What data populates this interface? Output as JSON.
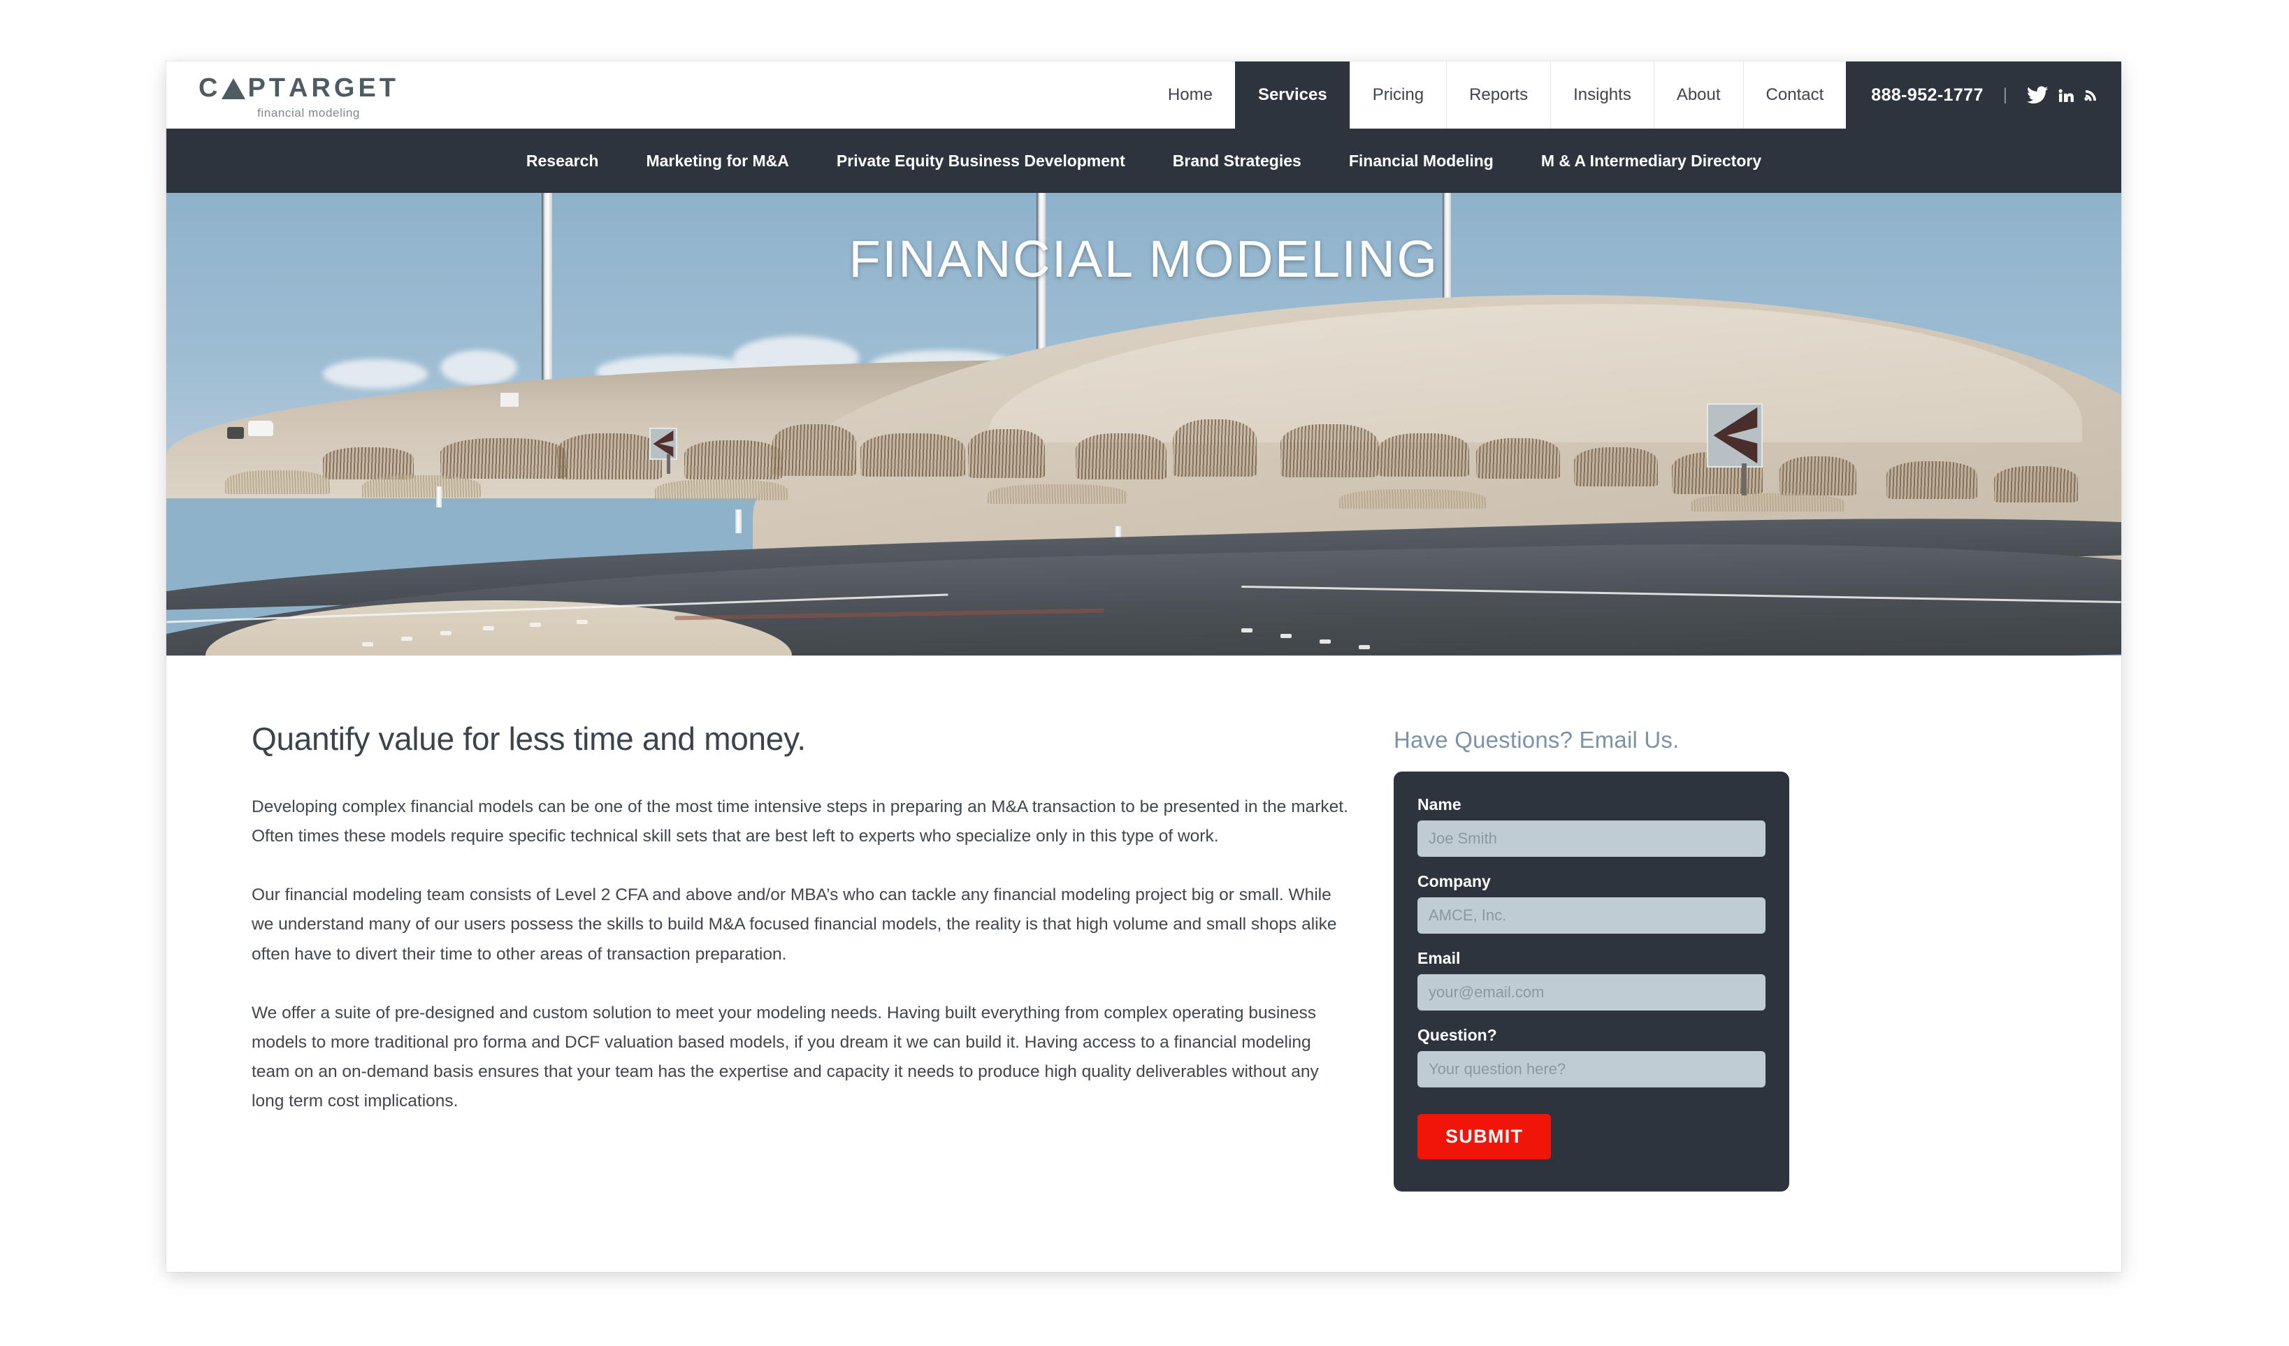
{
  "brand": {
    "name_part1": "C",
    "name_part2": "PT",
    "name_part3": "ARGET",
    "tagline": "financial modeling",
    "accent_color": "#4e5b63"
  },
  "header": {
    "nav": [
      {
        "label": "Home",
        "active": false
      },
      {
        "label": "Services",
        "active": true
      },
      {
        "label": "Pricing",
        "active": false
      },
      {
        "label": "Reports",
        "active": false
      },
      {
        "label": "Insights",
        "active": false
      },
      {
        "label": "About",
        "active": false
      },
      {
        "label": "Contact",
        "active": false
      }
    ],
    "phone": "888-952-1777",
    "separator": "|",
    "social": [
      {
        "name": "twitter-icon"
      },
      {
        "name": "linkedin-icon"
      },
      {
        "name": "rss-icon"
      }
    ]
  },
  "subnav": {
    "items": [
      {
        "label": "Research"
      },
      {
        "label": "Marketing for M&A"
      },
      {
        "label": "Private Equity Business Development"
      },
      {
        "label": "Brand Strategies"
      },
      {
        "label": "Financial Modeling"
      },
      {
        "label": "M & A Intermediary Directory"
      }
    ]
  },
  "hero": {
    "title": "FINANCIAL MODELING"
  },
  "main": {
    "headline": "Quantify value for less time and money.",
    "paragraphs": [
      "Developing complex financial models can be one of the most time intensive steps in preparing an M&A transaction to be presented in the market. Often times these models require specific technical skill sets that are best left to experts who specialize only in this type of work.",
      "Our financial modeling team consists of Level 2 CFA and above and/or MBA’s who can tackle any financial modeling project big or small. While we understand many of our users possess the skills to build M&A focused financial models, the reality is that high volume and small shops alike often have to divert their time to other areas of transaction preparation.",
      "We offer a suite of pre-designed and custom solution to meet your modeling needs. Having built everything from complex operating business models to more traditional pro forma and DCF valuation based models, if you dream it we can build it. Having access to a financial modeling team on an on-demand basis ensures that your team has the expertise and capacity it needs to produce high quality deliverables without any long term cost implications."
    ]
  },
  "form": {
    "heading": "Have Questions? Email Us.",
    "fields": [
      {
        "label": "Name",
        "placeholder": "Joe Smith",
        "value": ""
      },
      {
        "label": "Company",
        "placeholder": "AMCE, Inc.",
        "value": ""
      },
      {
        "label": "Email",
        "placeholder": "your@email.com",
        "value": ""
      },
      {
        "label": "Question?",
        "placeholder": "Your question here?",
        "value": ""
      }
    ],
    "submit_label": "SUBMIT",
    "submit_color": "#f01409",
    "panel_color": "#2e343d",
    "input_color": "#c0ccd4",
    "heading_color": "#7b93a8"
  }
}
